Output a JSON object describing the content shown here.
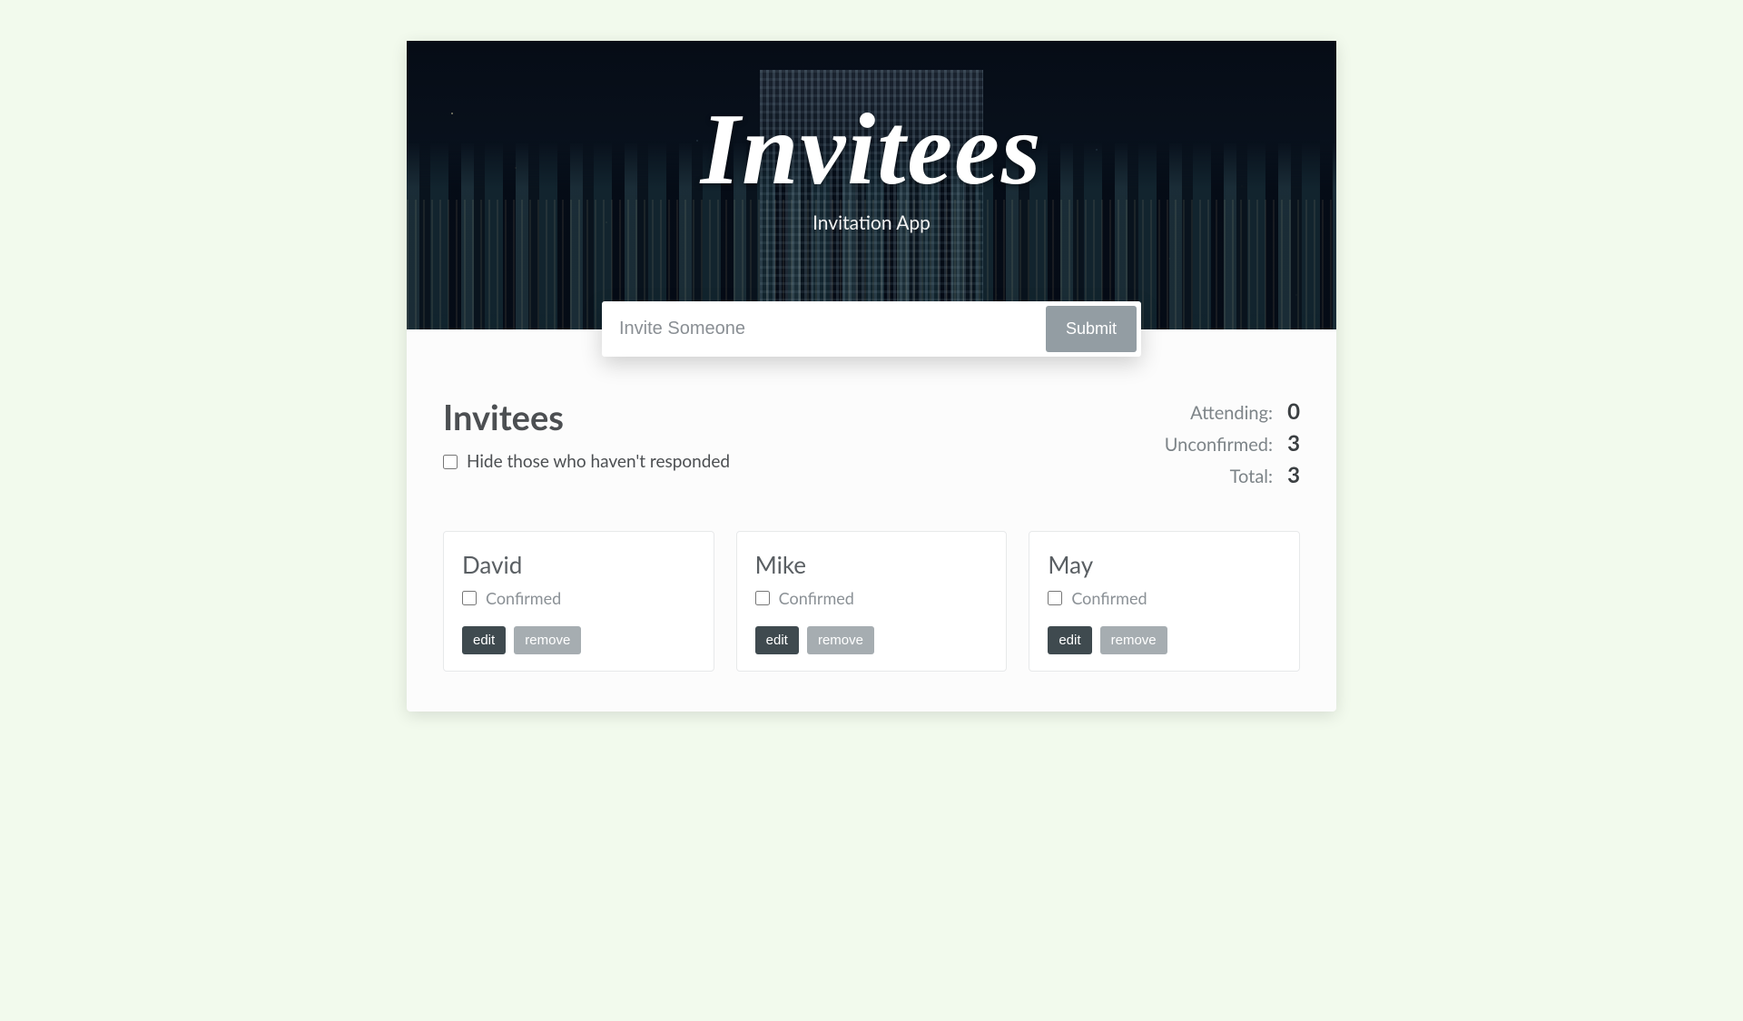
{
  "header": {
    "title": "Invitees",
    "subtitle": "Invitation App"
  },
  "form": {
    "placeholder": "Invite Someone",
    "submit_label": "Submit"
  },
  "main": {
    "heading": "Invitees",
    "filter_label": "Hide those who haven't responded"
  },
  "stats": {
    "attending_label": "Attending:",
    "attending_value": "0",
    "unconfirmed_label": "Unconfirmed:",
    "unconfirmed_value": "3",
    "total_label": "Total:",
    "total_value": "3"
  },
  "card_labels": {
    "confirmed": "Confirmed",
    "edit": "edit",
    "remove": "remove"
  },
  "invitees": [
    {
      "name": "David"
    },
    {
      "name": "Mike"
    },
    {
      "name": "May"
    }
  ]
}
